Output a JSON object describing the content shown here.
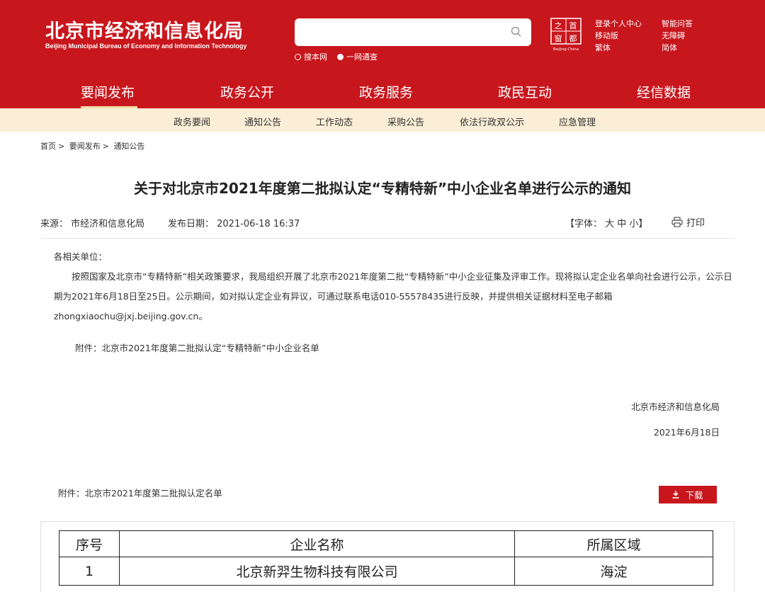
{
  "header": {
    "logo_cn": "北京市经济和信息化局",
    "logo_en": "Beijing Municipal Bureau of Economy and Information Technology",
    "search": {
      "placeholder": ""
    },
    "scope_options": [
      {
        "label": "搜本网",
        "selected": false
      },
      {
        "label": "一网通查",
        "selected": true
      }
    ],
    "seal": {
      "chars": [
        "首",
        "都",
        "之",
        "窗"
      ],
      "caption": "Beijing·China"
    },
    "links_col_a": [
      "登录个人中心",
      "移动版",
      "繁体"
    ],
    "links_col_b": [
      "智能问答",
      "无障碍",
      "简体"
    ],
    "bg_color": "#c8161d"
  },
  "nav": {
    "items": [
      "要闻发布",
      "政务公开",
      "政务服务",
      "政民互动",
      "经信数据"
    ],
    "active": "要闻发布"
  },
  "subnav": {
    "items": [
      "政务要闻",
      "通知公告",
      "工作动态",
      "采购公告",
      "依法行政双公示",
      "应急管理"
    ]
  },
  "breadcrumb": [
    "首页",
    "要闻发布",
    "通知公告"
  ],
  "article": {
    "title": "关于对北京市2021年度第二批拟认定“专精特新”中小企业名单进行公示的通知",
    "source": "来源：  市经济和信息化局",
    "date": "发布日期：  2021-06-18 16:37",
    "font_size_ctrl": "【字体：  大  中  小】",
    "print_label": "打印",
    "greeting": "各相关单位：",
    "paragraph": "按照国家及北京市“专精特新”相关政策要求，我局组织开展了北京市2021年度第二批“专精特新”中小企业征集及评审工作。现将拟认定企业名单向社会进行公示，公示日期为2021年6月18日至25日。公示期间，如对拟认定企业有异议，可通过联系电话010-55578435进行反映，并提供相关证据材料至电子邮箱zhongxiaochu@jxj.beijing.gov.cn。",
    "attachment_note": "附件：北京市2021年度第二批拟认定“专精特新”中小企业名单",
    "sign_org": "北京市经济和信息化局",
    "sign_date": "2021年6月18日"
  },
  "attachment": {
    "label": "附件：北京市2021年度第二批拟认定名单",
    "download_label": "下载"
  },
  "table": {
    "headers": [
      "序号",
      "企业名称",
      "所属区域"
    ],
    "rows": [
      [
        "1",
        "北京新羿生物科技有限公司",
        "海淀"
      ]
    ]
  }
}
